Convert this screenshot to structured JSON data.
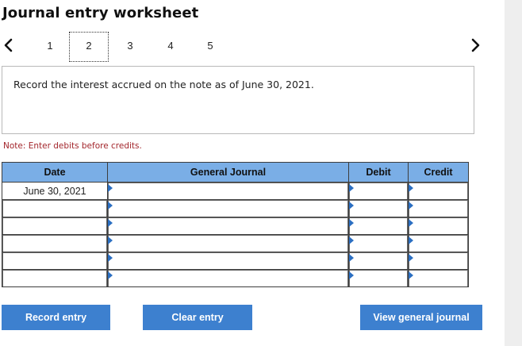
{
  "title": "Journal entry worksheet",
  "pager": {
    "pages": [
      "1",
      "2",
      "3",
      "4",
      "5"
    ],
    "active_index": 1
  },
  "prompt": "Record the interest accrued on the note as of June 30, 2021.",
  "note": "Note: Enter debits before credits.",
  "table": {
    "headers": {
      "date": "Date",
      "general_journal": "General Journal",
      "debit": "Debit",
      "credit": "Credit"
    },
    "rows": [
      {
        "date": "June 30, 2021",
        "account": "",
        "debit": "",
        "credit": ""
      },
      {
        "date": "",
        "account": "",
        "debit": "",
        "credit": ""
      },
      {
        "date": "",
        "account": "",
        "debit": "",
        "credit": ""
      },
      {
        "date": "",
        "account": "",
        "debit": "",
        "credit": ""
      },
      {
        "date": "",
        "account": "",
        "debit": "",
        "credit": ""
      },
      {
        "date": "",
        "account": "",
        "debit": "",
        "credit": ""
      }
    ]
  },
  "buttons": {
    "record": "Record entry",
    "clear": "Clear entry",
    "view": "View general journal"
  },
  "colors": {
    "header_bg": "#7aaee6",
    "button_bg": "#3d80cf",
    "note_text": "#a3262c",
    "marker": "#2b6fc2"
  },
  "icons": {
    "prev": "chevron-left-icon",
    "next": "chevron-right-icon"
  }
}
